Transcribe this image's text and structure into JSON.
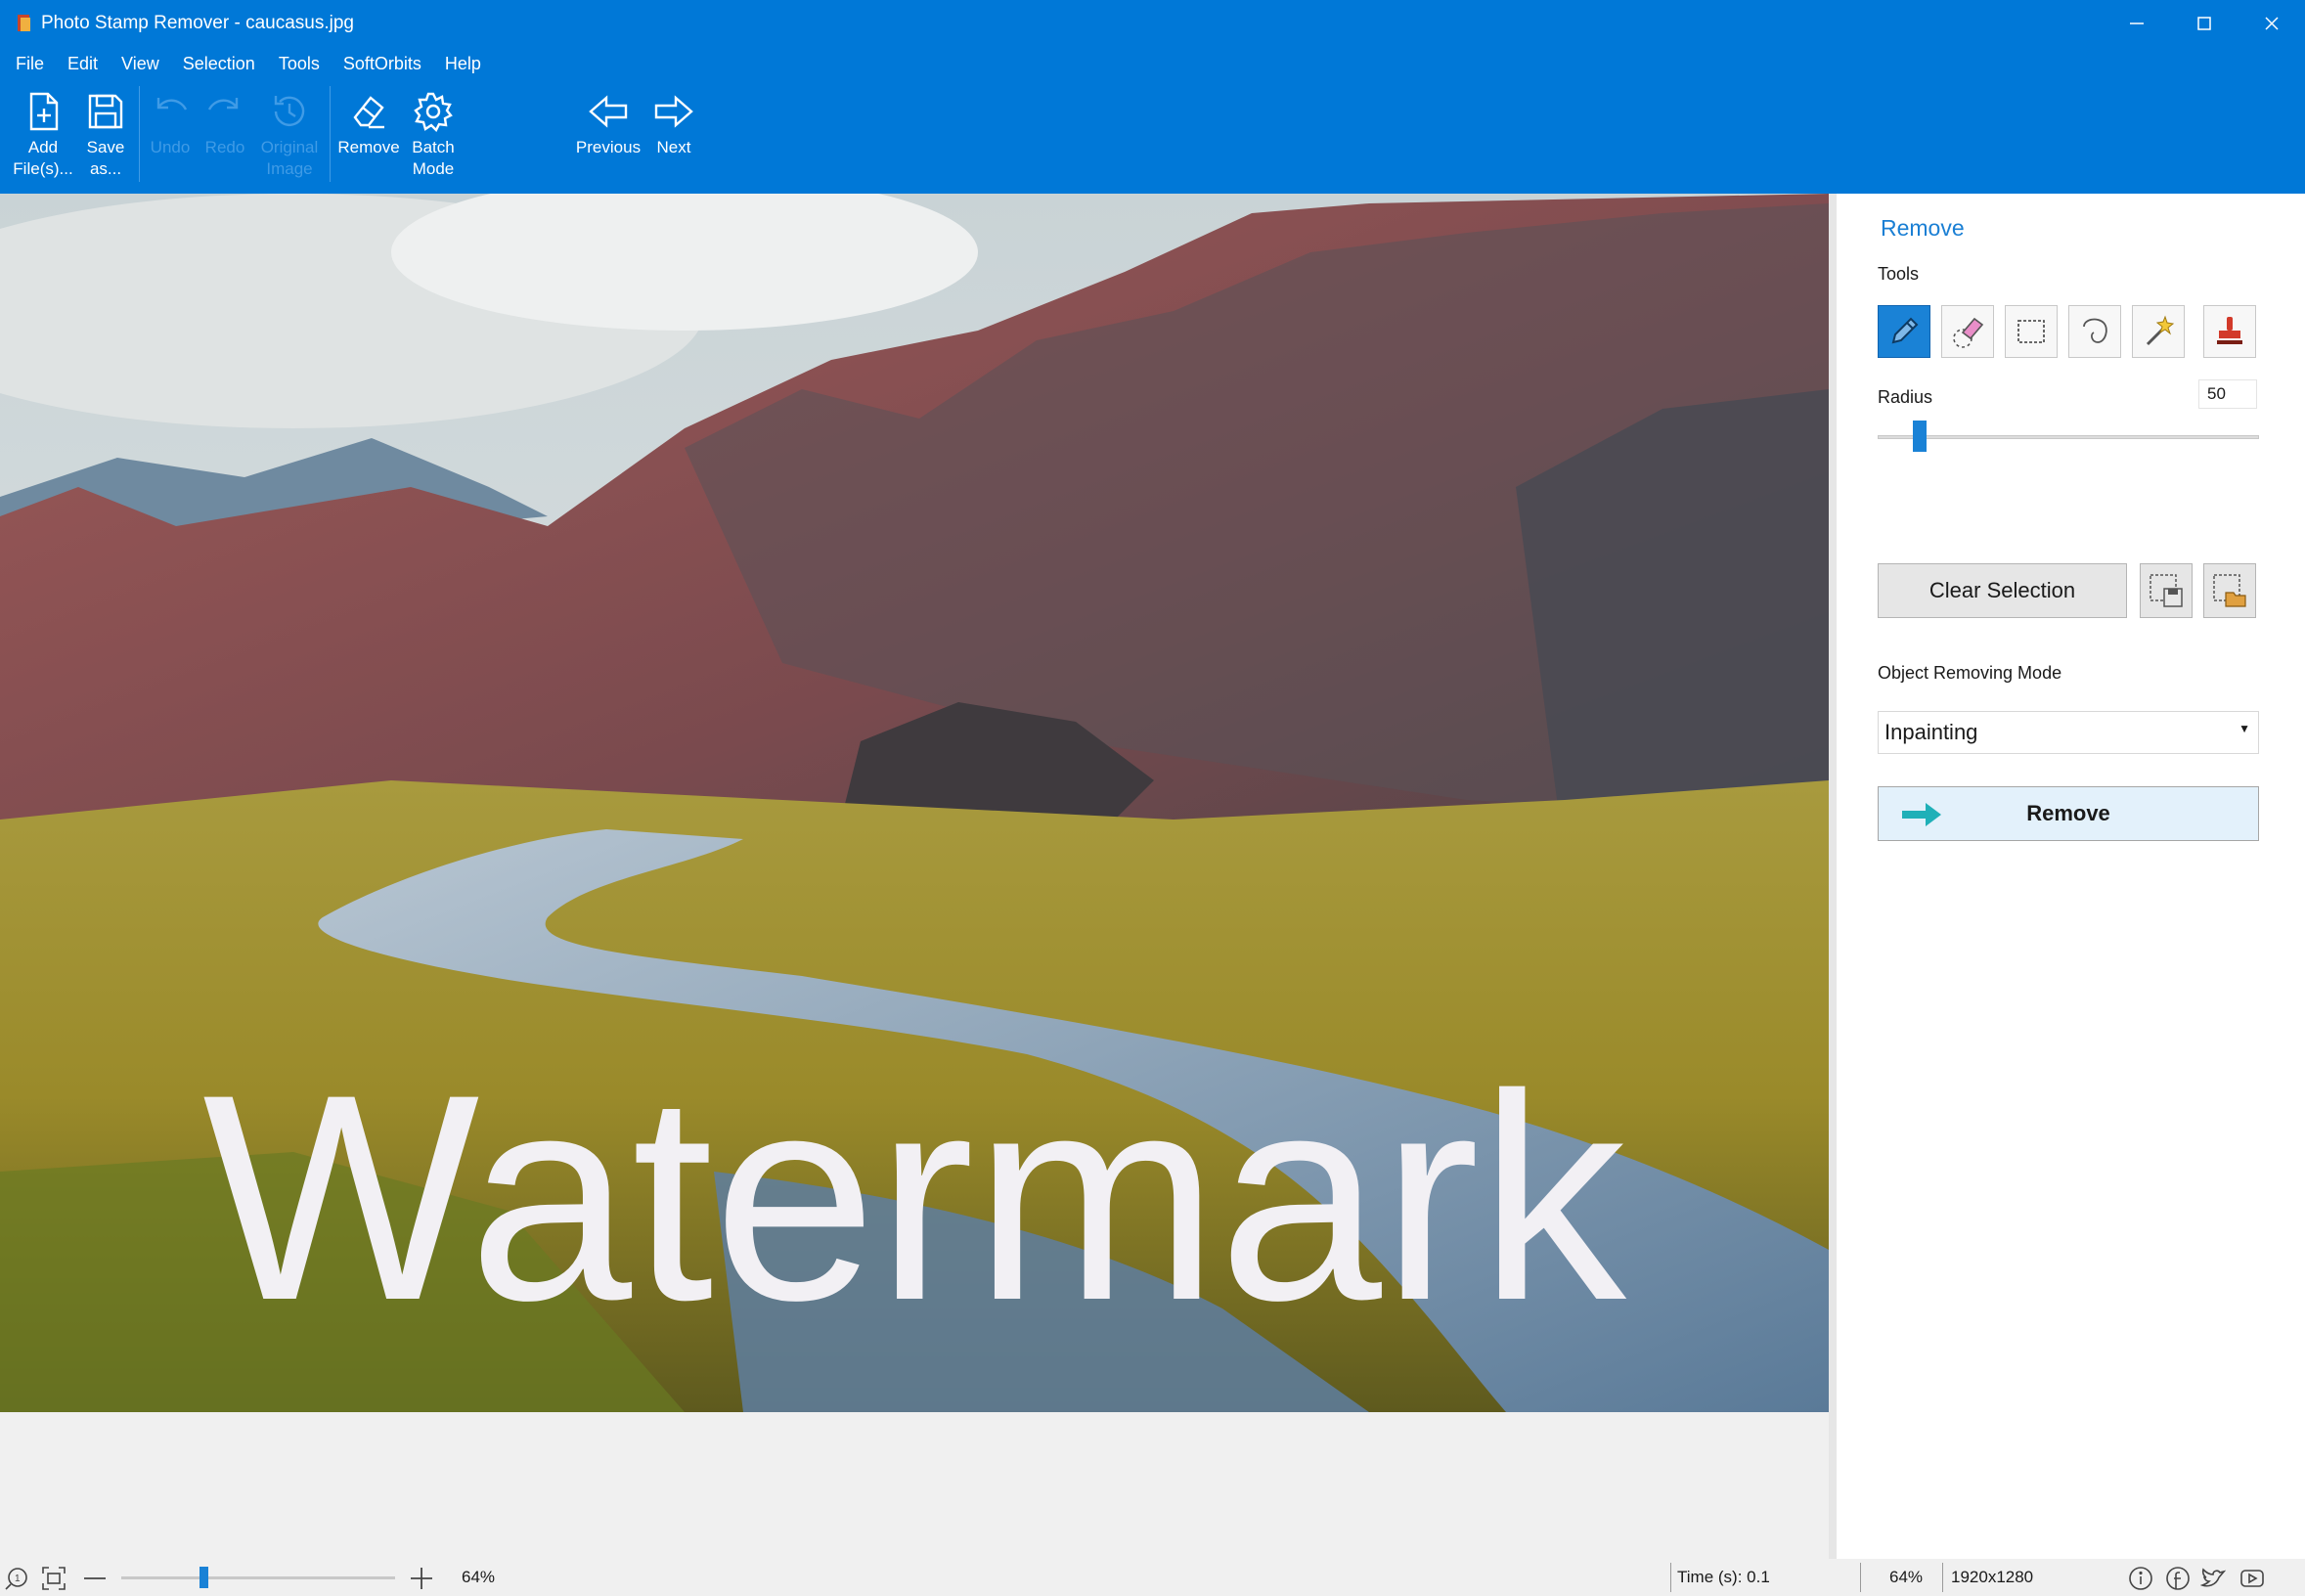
{
  "window": {
    "title": "Photo Stamp Remover - caucasus.jpg"
  },
  "menu": [
    "File",
    "Edit",
    "View",
    "Selection",
    "Tools",
    "SoftOrbits",
    "Help"
  ],
  "toolbar": {
    "add_files": "Add\nFile(s)...",
    "save_as": "Save\nas...",
    "undo": "Undo",
    "redo": "Redo",
    "original_image": "Original\nImage",
    "remove": "Remove",
    "batch_mode": "Batch\nMode",
    "previous": "Previous",
    "next": "Next"
  },
  "canvas": {
    "watermark_text": "Watermark"
  },
  "panel": {
    "title": "Remove",
    "tools_label": "Tools",
    "tools": [
      "pencil-icon",
      "eraser-icon",
      "rect-select-icon",
      "lasso-icon",
      "magic-wand-icon",
      "stamp-icon"
    ],
    "radius_label": "Radius",
    "radius_value": "50",
    "radius_level": 0.11,
    "clear_selection": "Clear Selection",
    "mode_label": "Object Removing Mode",
    "mode_value": "Inpainting",
    "remove_button": "Remove"
  },
  "status": {
    "zoom_percent": "64%",
    "zoom_level": 0.3,
    "time": "Time (s): 0.1",
    "zoom_readout": "64%",
    "image_size": "1920x1280"
  },
  "colors": {
    "accent": "#0078d7",
    "active_tool": "#1a82d6",
    "panel_title": "#1a7fd4",
    "watermark": "#f2f0f4"
  }
}
